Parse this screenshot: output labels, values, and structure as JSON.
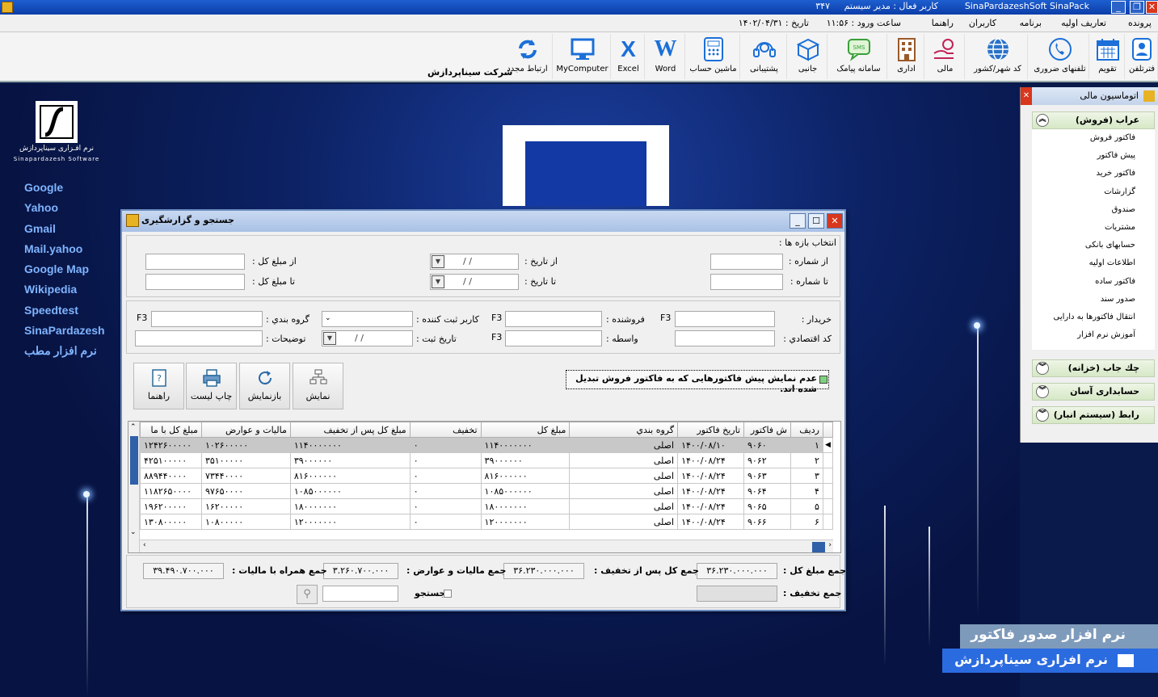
{
  "titlebar": {
    "app": "SinaPardazeshSoft SinaPack",
    "user": "کاربر فعال : مدیر سیستم",
    "num": "۳۴۷"
  },
  "menu": {
    "items": [
      "پرونده",
      "تعاریف اولیه",
      "برنامه",
      "کاربران",
      "راهنما"
    ],
    "login_time": "ساعت ورود : ۱۱:۵۶",
    "date": "تاریخ : ۱۴۰۲/۰۴/۳۱"
  },
  "toolbar": {
    "company": "شرکت سیناپردازش",
    "buttons": [
      {
        "label": "ارتباط مجدد",
        "icon": "refresh-icon"
      },
      {
        "label": "MyComputer",
        "icon": "monitor-icon"
      },
      {
        "label": "Excel",
        "icon": "excel-icon"
      },
      {
        "label": "Word",
        "icon": "word-icon"
      },
      {
        "label": "ماشین حساب",
        "icon": "calculator-icon"
      },
      {
        "label": "پشتیبانی",
        "icon": "headset-icon"
      },
      {
        "label": "جانبی",
        "icon": "box-icon"
      },
      {
        "label": "سامانه پیامک",
        "icon": "sms-icon"
      },
      {
        "label": "اداری",
        "icon": "building-icon"
      },
      {
        "label": "مالی",
        "icon": "money-hand-icon"
      },
      {
        "label": "کد شهر/کشور",
        "icon": "globe-icon"
      },
      {
        "label": "تلفنهای ضروری",
        "icon": "phone-icon"
      },
      {
        "label": "تقویم",
        "icon": "calendar-icon"
      },
      {
        "label": "فترتلفن",
        "icon": "contact-icon"
      }
    ]
  },
  "desktop": {
    "logo_text": "نرم افـزاری سیناپردازش",
    "logo_sub": "Sinapardazesh Software",
    "links": [
      "Google",
      "Yahoo",
      "Gmail",
      "Mail.yahoo",
      "Google Map",
      "Wikipedia",
      "Speedtest",
      "SinaPardazesh",
      "نرم افزار مطب"
    ]
  },
  "right_panel": {
    "title": "اتوماسیون مالی",
    "section1": "عراب (فروش)",
    "items": [
      "فاکتور فروش",
      "پیش فاکتور",
      "فاکتور خرید",
      "گزارشات",
      "صندوق",
      "مشتریات",
      "حسابهای بانکی",
      "اطلاعات اولیه",
      "فاکتور ساده",
      "صدور سند",
      "انتقال فاکتورها به دارایی",
      "آموزش نرم افزار"
    ],
    "sections": [
      "چك جاب (خزانه)",
      "حسابداری آسان",
      "رابط (سیستم انبار)"
    ]
  },
  "brand": {
    "line1": "نرم افزار صدور فاکتور",
    "line2": "نرم افزاری سیناپردازش"
  },
  "dialog": {
    "title": "جستجو و گزارشگیری",
    "range_label": "انتخاب بازه ها :",
    "from_number": "از شماره :",
    "to_number": "تا شماره :",
    "from_date": "از تاریخ :",
    "to_date": "تا تاریخ :",
    "from_amount": "از مبلغ کل :",
    "to_amount": "تا مبلغ کل :",
    "date_placeholder": "/   /",
    "buyer": "خریدار :",
    "seller": "فروشنده :",
    "reg_user": "کاربر ثبت کننده :",
    "category": "گروه بندي :",
    "econ_code": "کد اقتصادي :",
    "agent": "واسطه :",
    "reg_date": "تاریخ ثبت :",
    "notes": "توضیحات :",
    "f3": "F3",
    "checkbox_label": "عدم نمایش پیش فاکتورهایی که به فاکتور فروش تبدیل شده اند.",
    "buttons": {
      "show": "نمایش",
      "reshow": "بازنمایش",
      "print": "چاپ لیست",
      "help": "راهنما"
    },
    "table": {
      "headers": [
        "رديف",
        "ش فاکتور",
        "تاريخ فاکتور",
        "گروه بندي",
        "مبلغ کل",
        "تخفيف",
        "مبلغ کل پس از تخفيف",
        "ماليات و عوارض",
        "مبلغ کل با ما"
      ],
      "rows": [
        [
          "۱",
          "۹۰۶۰",
          "۱۴۰۰/۰۸/۱۰",
          "اصلی",
          "۱۱۴۰۰۰۰۰۰۰",
          "۰",
          "۱۱۴۰۰۰۰۰۰۰",
          "۱۰۲۶۰۰۰۰۰",
          "۱۲۴۲۶۰۰۰۰۰"
        ],
        [
          "۲",
          "۹۰۶۲",
          "۱۴۰۰/۰۸/۲۴",
          "اصلی",
          "۳۹۰۰۰۰۰۰",
          "۰",
          "۳۹۰۰۰۰۰۰",
          "۳۵۱۰۰۰۰۰",
          "۴۲۵۱۰۰۰۰۰"
        ],
        [
          "۳",
          "۹۰۶۳",
          "۱۴۰۰/۰۸/۲۴",
          "اصلی",
          "۸۱۶۰۰۰۰۰۰",
          "۰",
          "۸۱۶۰۰۰۰۰۰",
          "۷۳۴۴۰۰۰۰",
          "۸۸۹۴۴۰۰۰۰"
        ],
        [
          "۴",
          "۹۰۶۴",
          "۱۴۰۰/۰۸/۲۴",
          "اصلی",
          "۱۰۸۵۰۰۰۰۰۰",
          "۰",
          "۱۰۸۵۰۰۰۰۰۰",
          "۹۷۶۵۰۰۰۰",
          "۱۱۸۲۶۵۰۰۰۰"
        ],
        [
          "۵",
          "۹۰۶۵",
          "۱۴۰۰/۰۸/۲۴",
          "اصلی",
          "۱۸۰۰۰۰۰۰۰",
          "۰",
          "۱۸۰۰۰۰۰۰۰",
          "۱۶۲۰۰۰۰۰",
          "۱۹۶۲۰۰۰۰۰"
        ],
        [
          "۶",
          "۹۰۶۶",
          "۱۴۰۰/۰۸/۲۴",
          "اصلی",
          "۱۲۰۰۰۰۰۰۰",
          "۰",
          "۱۲۰۰۰۰۰۰۰",
          "۱۰۸۰۰۰۰۰",
          "۱۳۰۸۰۰۰۰۰"
        ]
      ]
    },
    "summary": {
      "total_label": "جمع مبلغ کل :",
      "total": "۳۶.۲۳۰.۰۰۰.۰۰۰",
      "after_disc_label": "جمع کل پس از تخفیف :",
      "after_disc": "۳۶.۲۳۰.۰۰۰.۰۰۰",
      "tax_label": "جمع مالیات و عوارض :",
      "tax": "۳.۲۶۰.۷۰۰.۰۰۰",
      "with_tax_label": "جمع همراه با مالیات :",
      "with_tax": "۳۹.۴۹۰.۷۰۰.۰۰۰",
      "discount_label": "جمع تخفیف :",
      "discount": "",
      "search_label": "جستجو"
    }
  },
  "colors": {
    "titlebar": "#1e5fd0",
    "link": "#7fb4ff",
    "brand_blue": "#2b6be0",
    "close_red": "#d8371d"
  }
}
